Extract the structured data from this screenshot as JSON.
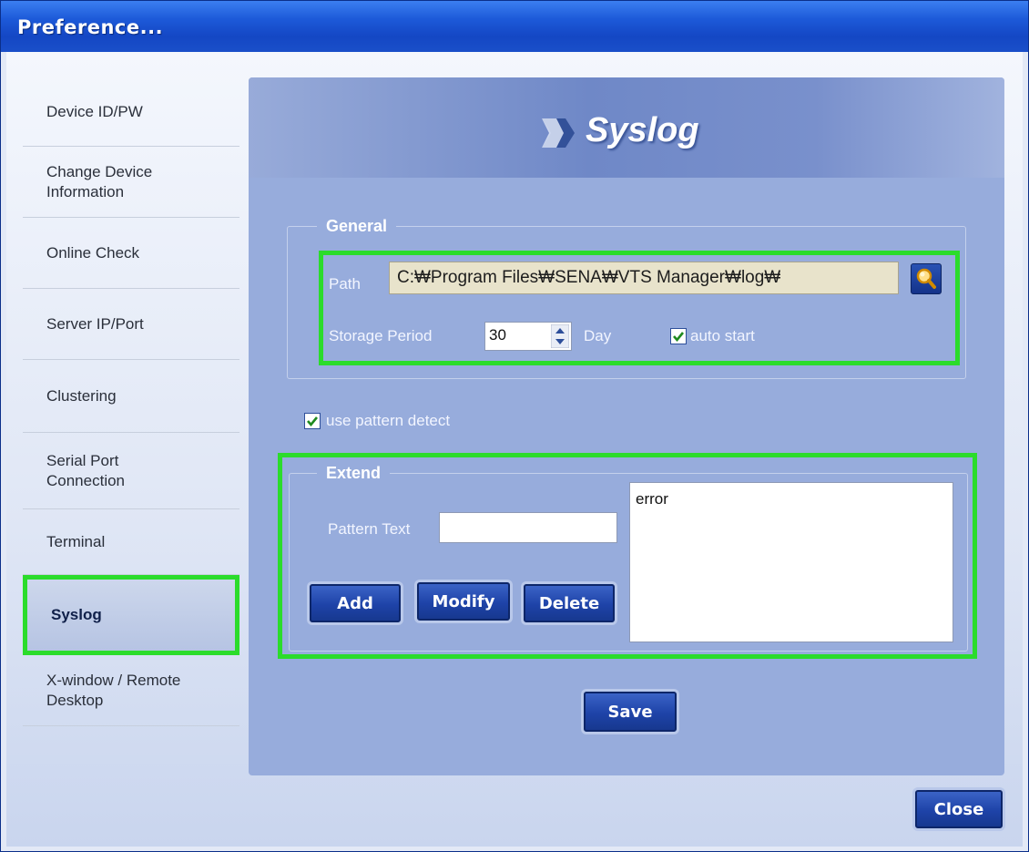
{
  "window": {
    "title": "Preference..."
  },
  "sidebar": {
    "items": [
      {
        "label": "Device ID/PW",
        "active": false
      },
      {
        "label": "Change Device Information",
        "active": false
      },
      {
        "label": "Online Check",
        "active": false
      },
      {
        "label": "Server IP/Port",
        "active": false
      },
      {
        "label": "Clustering",
        "active": false
      },
      {
        "label": "Serial Port Connection",
        "active": false
      },
      {
        "label": "Terminal",
        "active": false
      },
      {
        "label": "Syslog",
        "active": true
      },
      {
        "label": "X-window / Remote Desktop",
        "active": false
      }
    ]
  },
  "panel": {
    "title": "Syslog",
    "general": {
      "legend": "General",
      "path_label": "Path",
      "path_value": "C:₩Program Files₩SENA₩VTS Manager₩log₩",
      "storage_label": "Storage Period",
      "storage_value": "30",
      "storage_unit": "Day",
      "auto_start_label": "auto start",
      "auto_start_checked": true
    },
    "use_pattern_detect": {
      "label": "use pattern detect",
      "checked": true
    },
    "extend": {
      "legend": "Extend",
      "pattern_text_label": "Pattern Text",
      "pattern_text_value": "",
      "add_label": "Add",
      "modify_label": "Modify",
      "delete_label": "Delete",
      "patterns": [
        "error"
      ]
    },
    "save_label": "Save"
  },
  "close_label": "Close",
  "icons": {
    "search": "search-icon",
    "arrow": "arrow-icon",
    "check": "check-icon"
  },
  "colors": {
    "highlight": "#2bdc2b",
    "titlebar": "#1d5ad9",
    "button": "#1e43a8"
  }
}
